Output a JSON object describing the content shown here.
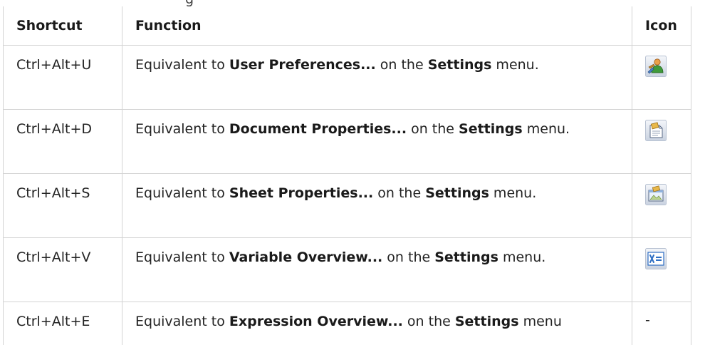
{
  "caption_fragment": "g",
  "headers": {
    "shortcut": "Shortcut",
    "function": "Function",
    "icon": "Icon"
  },
  "rows": [
    {
      "shortcut": "Ctrl+Alt+U",
      "prefix": "Equivalent to ",
      "command": "User Preferences...",
      "middle": " on the ",
      "menu": "Settings",
      "suffix": " menu.",
      "icon": "user-preferences-icon"
    },
    {
      "shortcut": "Ctrl+Alt+D",
      "prefix": "Equivalent to ",
      "command": "Document Properties...",
      "middle": " on the ",
      "menu": "Settings",
      "suffix": " menu.",
      "icon": "document-properties-icon"
    },
    {
      "shortcut": "Ctrl+Alt+S",
      "prefix": "Equivalent to ",
      "command": "Sheet Properties...",
      "middle": " on the ",
      "menu": "Settings",
      "suffix": " menu.",
      "icon": "sheet-properties-icon"
    },
    {
      "shortcut": "Ctrl+Alt+V",
      "prefix": "Equivalent to ",
      "command": "Variable Overview...",
      "middle": " on the ",
      "menu": "Settings",
      "suffix": " menu.",
      "icon": "variable-overview-icon"
    },
    {
      "shortcut": "Ctrl+Alt+E",
      "prefix": "Equivalent to ",
      "command": "Expression Overview...",
      "middle": " on the ",
      "menu": "Settings",
      "suffix": " menu",
      "icon_text": "-"
    }
  ],
  "colors": {
    "border": "#d3d3d3",
    "icon_blue": "#2e6fc4",
    "icon_gold": "#e8b84a",
    "icon_green": "#3f9a3a"
  }
}
